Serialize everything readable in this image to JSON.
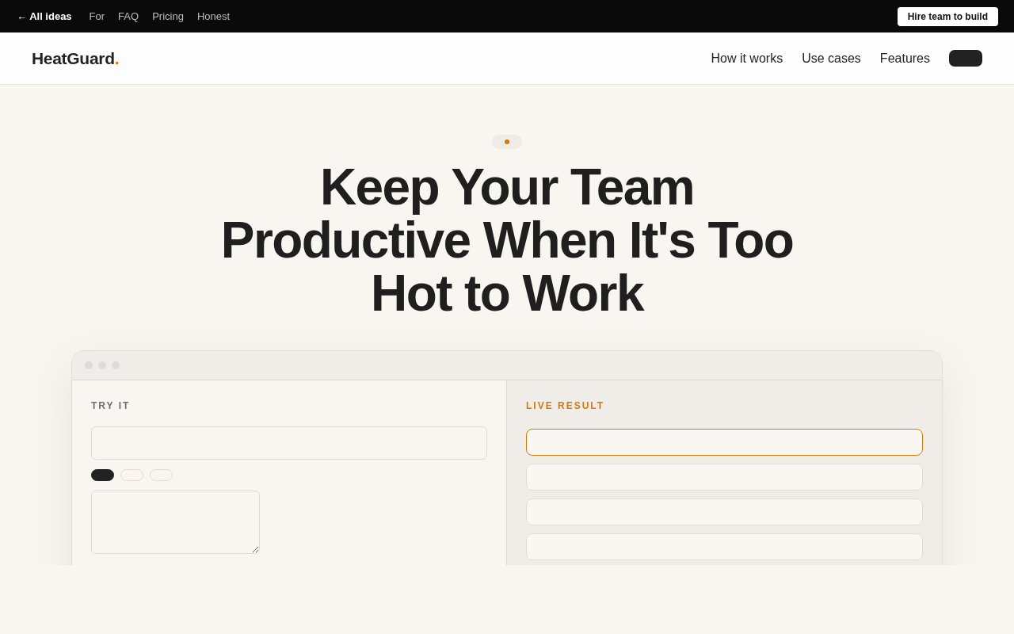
{
  "top_bar": {
    "back_link": "← All ideas",
    "links": [
      "For",
      "FAQ",
      "Pricing",
      "Honest"
    ],
    "cta_button": "Hire team to build"
  },
  "header": {
    "logo": {
      "text": "HeatGuard",
      "accent": "."
    },
    "nav": [
      "How it works",
      "Use cases",
      "Features"
    ]
  },
  "hero": {
    "heading": "Keep Your Team Productive When It's Too Hot to Work"
  },
  "demo": {
    "input_panel": {
      "label": "TRY IT",
      "chips": [
        {
          "selected": true
        },
        {
          "selected": false
        },
        {
          "selected": false
        }
      ]
    },
    "result_panel": {
      "label": "LIVE RESULT",
      "rows": [
        {
          "selected": true
        },
        {
          "selected": false
        },
        {
          "selected": false
        },
        {
          "selected": false
        }
      ]
    }
  }
}
